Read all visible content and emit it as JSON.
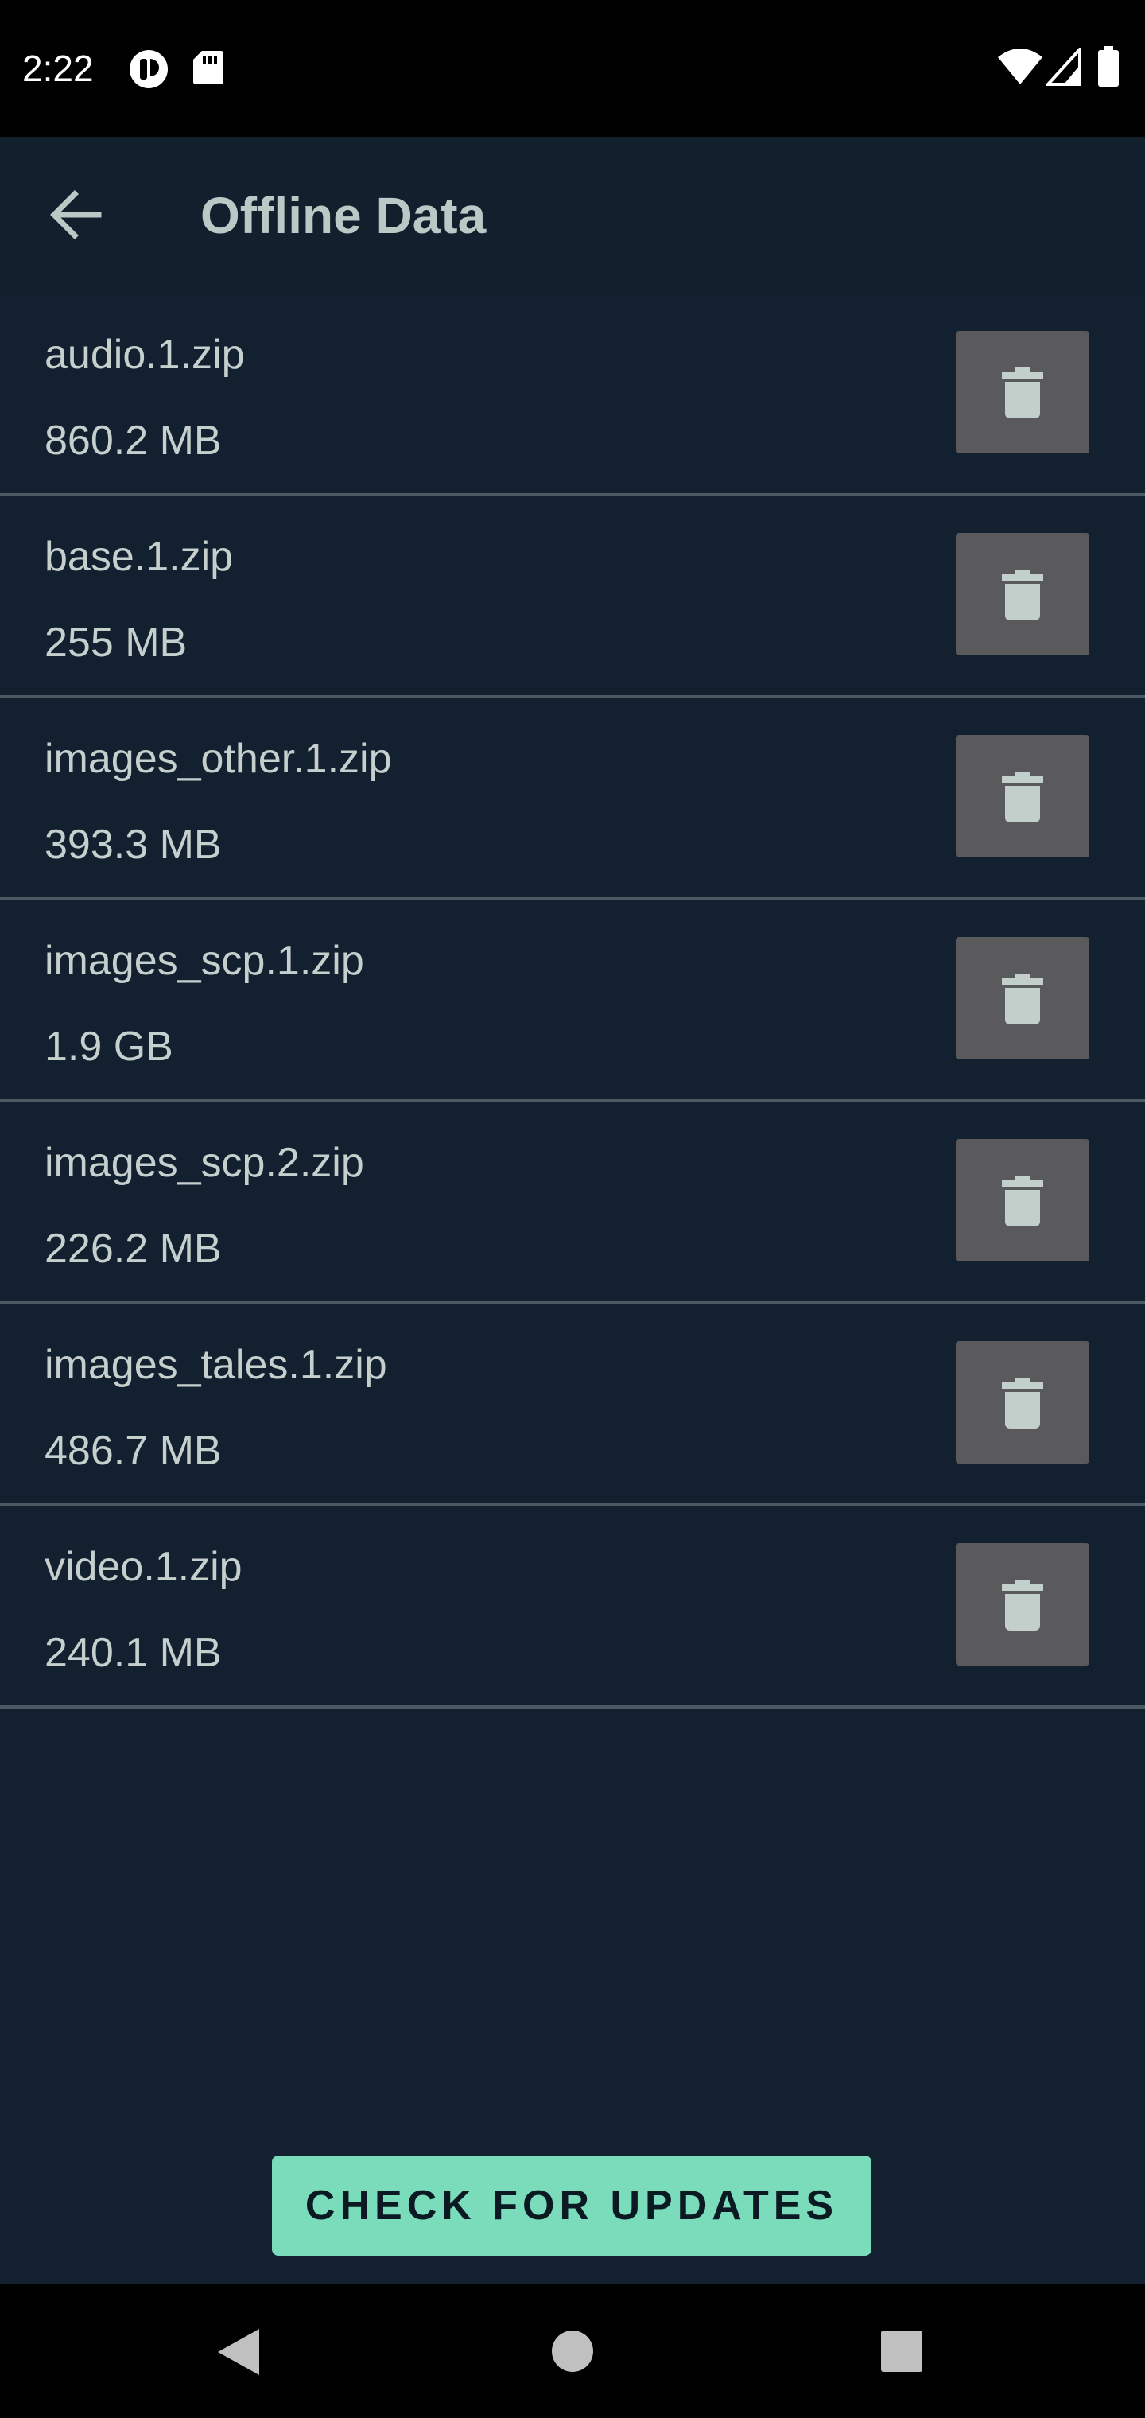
{
  "status_bar": {
    "time": "2:22",
    "icons": [
      "notification-app-icon",
      "sd-card-icon",
      "wifi-icon",
      "cell-signal-icon",
      "battery-icon"
    ]
  },
  "app_bar": {
    "title": "Offline Data",
    "back_icon": "arrow-back-icon"
  },
  "files": [
    {
      "name": "audio.1.zip",
      "size": "860.2 MB"
    },
    {
      "name": "base.1.zip",
      "size": "255 MB"
    },
    {
      "name": "images_other.1.zip",
      "size": "393.3 MB"
    },
    {
      "name": "images_scp.1.zip",
      "size": "1.9 GB"
    },
    {
      "name": "images_scp.2.zip",
      "size": "226.2 MB"
    },
    {
      "name": "images_tales.1.zip",
      "size": "486.7 MB"
    },
    {
      "name": "video.1.zip",
      "size": "240.1 MB"
    }
  ],
  "delete_icon": "trash-icon",
  "actions": {
    "check_updates_label": "CHECK FOR UPDATES"
  },
  "nav_bar": {
    "icons": [
      "nav-back-icon",
      "nav-home-icon",
      "nav-recents-icon"
    ]
  },
  "colors": {
    "background": "#13202f",
    "accent": "#7adcba",
    "delete_button": "#5a5a5c",
    "text": "#c5cfcd",
    "divider": "#4b5a62"
  }
}
